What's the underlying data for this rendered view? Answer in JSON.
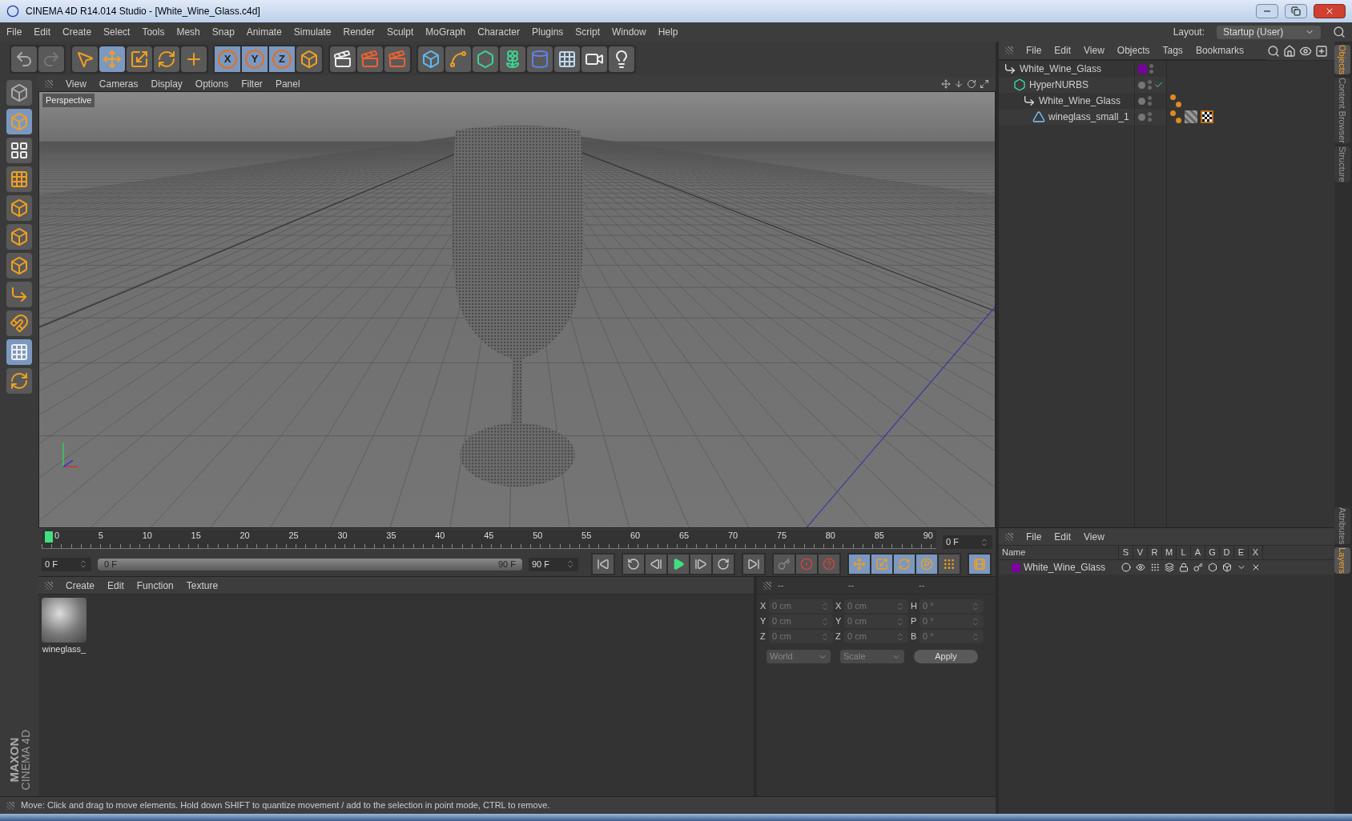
{
  "window": {
    "title": "CINEMA 4D R14.014 Studio - [White_Wine_Glass.c4d]"
  },
  "menu_bar": [
    "File",
    "Edit",
    "Create",
    "Select",
    "Tools",
    "Mesh",
    "Snap",
    "Animate",
    "Simulate",
    "Render",
    "Sculpt",
    "MoGraph",
    "Character",
    "Plugins",
    "Script",
    "Window",
    "Help"
  ],
  "layout": {
    "label": "Layout:",
    "value": "Startup (User)"
  },
  "toolbar": {
    "axis_buttons": [
      {
        "label": "X",
        "selected": true
      },
      {
        "label": "Y",
        "selected": true
      },
      {
        "label": "Z",
        "selected": true
      }
    ]
  },
  "viewport": {
    "menu": [
      "View",
      "Cameras",
      "Display",
      "Options",
      "Filter",
      "Panel"
    ],
    "camera_label": "Perspective"
  },
  "timeline": {
    "ticks": [
      "0",
      "5",
      "10",
      "15",
      "20",
      "25",
      "30",
      "35",
      "40",
      "45",
      "50",
      "55",
      "60",
      "65",
      "70",
      "75",
      "80",
      "85",
      "90"
    ],
    "playhead": {
      "level": 0
    },
    "current_frame": "0 F",
    "start_frame": "0 F",
    "range": {
      "level": 1,
      "start": "0 F",
      "end": "90 F"
    },
    "end_frame": "90 F"
  },
  "material_manager": {
    "menu": [
      "Create",
      "Edit",
      "Function",
      "Texture"
    ],
    "materials": [
      {
        "name": "wineglass_"
      }
    ]
  },
  "coordinates": {
    "disabled": true,
    "headers": [
      "--",
      "--",
      "--"
    ],
    "rows": [
      [
        {
          "label": "X",
          "value": "0 cm"
        },
        {
          "label": "X",
          "value": "0 cm"
        },
        {
          "label": "H",
          "value": "0 °"
        }
      ],
      [
        {
          "label": "Y",
          "value": "0 cm"
        },
        {
          "label": "Y",
          "value": "0 cm"
        },
        {
          "label": "P",
          "value": "0 °"
        }
      ],
      [
        {
          "label": "Z",
          "value": "0 cm"
        },
        {
          "label": "Z",
          "value": "0 cm"
        },
        {
          "label": "B",
          "value": "0 °"
        }
      ]
    ],
    "mode": "World",
    "transform": "Scale",
    "apply": "Apply"
  },
  "object_manager": {
    "menu": [
      "File",
      "Edit",
      "View",
      "Objects",
      "Tags",
      "Bookmarks"
    ],
    "objects": [
      {
        "name": "White_Wine_Glass",
        "kind": "null",
        "color": "#7a00a0",
        "children": [
          {
            "name": "HyperNURBS",
            "kind": "hypernurbs",
            "enabled": true,
            "children": [
              {
                "name": "White_Wine_Glass",
                "kind": "null",
                "tags": [
                  {
                    "kind": "phong"
                  }
                ],
                "children": [
                  {
                    "name": "wineglass_small_1",
                    "kind": "polygon",
                    "tags": [
                      {
                        "kind": "phong"
                      },
                      {
                        "kind": "material"
                      },
                      {
                        "kind": "texture"
                      }
                    ]
                  }
                ]
              }
            ]
          }
        ]
      }
    ]
  },
  "layer_manager": {
    "menu": [
      "File",
      "Edit",
      "View"
    ],
    "columns": [
      "Name",
      "S",
      "V",
      "R",
      "M",
      "L",
      "A",
      "G",
      "D",
      "E",
      "X"
    ],
    "layers": [
      {
        "name": "White_Wine_Glass",
        "color": "#7a00a0"
      }
    ]
  },
  "side_tabs_top": [
    {
      "label": "Objects",
      "selected": true
    },
    {
      "label": "Content Browser",
      "selected": false
    },
    {
      "label": "Structure",
      "selected": false
    }
  ],
  "side_tabs_bottom": [
    {
      "label": "Attributes",
      "selected": false
    },
    {
      "label": "Layers",
      "selected": true
    }
  ],
  "logo": {
    "brand": "MAXON",
    "product": "CINEMA 4D"
  },
  "status_bar": "Move: Click and drag to move elements. Hold down SHIFT to quantize movement / add to the selection in point mode, CTRL to remove."
}
